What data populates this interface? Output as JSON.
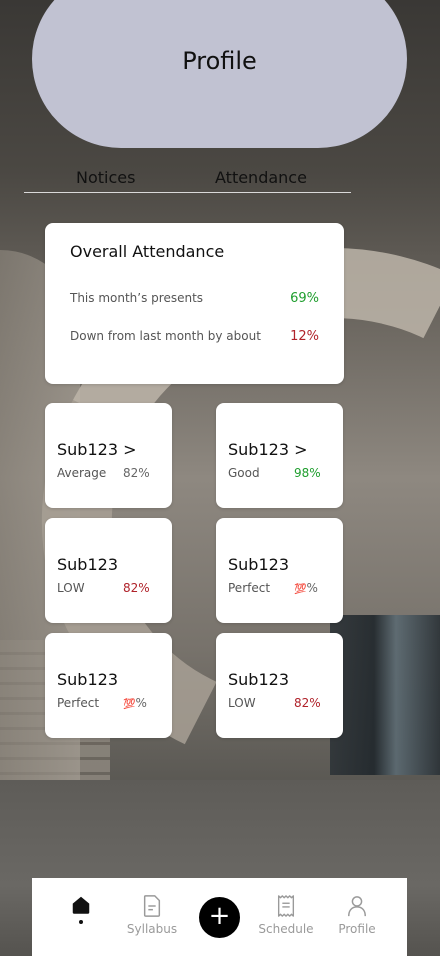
{
  "header": {
    "title": "Profile"
  },
  "tabs": [
    {
      "label": "Notices"
    },
    {
      "label": "Attendance"
    }
  ],
  "overall": {
    "heading": "Overall Attendance",
    "rows": [
      {
        "label": "This month’s presents",
        "value": "69%"
      },
      {
        "label": "Down from last month by about",
        "value": "12%"
      }
    ]
  },
  "subjects": [
    {
      "name": "Sub123 >",
      "status": "Average",
      "value": "82%"
    },
    {
      "name": "Sub123 >",
      "status": "Good",
      "value": "98%"
    },
    {
      "name": "Sub123",
      "status": "LOW",
      "value": "82%"
    },
    {
      "name": "Sub123",
      "status": "Perfect",
      "value_emoji": "💯",
      "value_suffix": "%"
    },
    {
      "name": "Sub123",
      "status": "Perfect",
      "value_emoji": "💯",
      "value_suffix": "%"
    },
    {
      "name": "Sub123",
      "status": "LOW",
      "value": "82%"
    }
  ],
  "nav": {
    "syllabus": "Syllabus",
    "plus": "+",
    "schedule": "Schedule",
    "profile": "Profile",
    "icons": [
      "home-icon",
      "document-icon",
      "plus-icon",
      "receipt-icon",
      "user-icon"
    ]
  },
  "colors": {
    "header_bg": "#c1c2d2",
    "green": "#1f9e2e",
    "red": "#b0222a"
  }
}
